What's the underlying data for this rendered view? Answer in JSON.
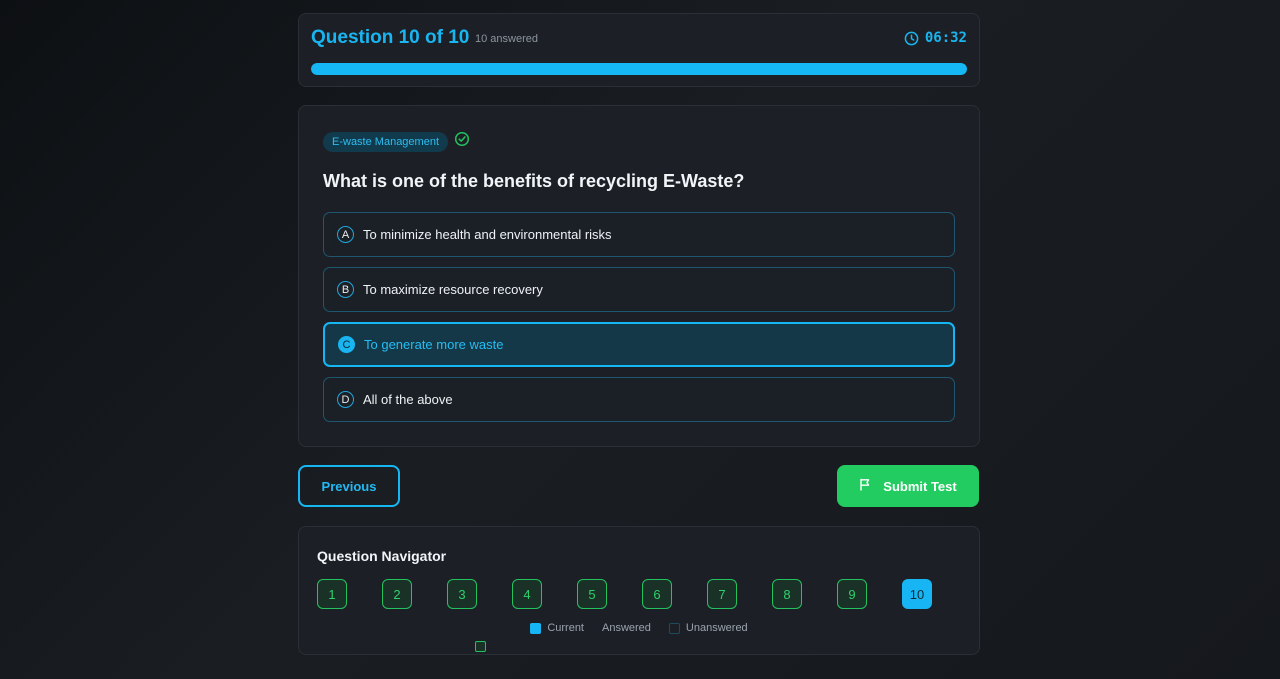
{
  "header": {
    "title": "Question 10 of 10",
    "answered": "10 answered",
    "timer": "06:32",
    "progress_fraction": 1.0,
    "accent_color": "#19b5f0"
  },
  "question": {
    "topic": "E-waste Management",
    "text": "What is one of the benefits of recycling E-Waste?",
    "options": [
      {
        "letter": "A",
        "text": "To minimize health and environmental risks",
        "selected": false
      },
      {
        "letter": "B",
        "text": "To maximize resource recovery",
        "selected": false
      },
      {
        "letter": "C",
        "text": "To generate more waste",
        "selected": true
      },
      {
        "letter": "D",
        "text": "All of the above",
        "selected": false
      }
    ]
  },
  "actions": {
    "previous_label": "Previous",
    "submit_label": "Submit Test",
    "submit_color": "#22cc60"
  },
  "navigator": {
    "title": "Question Navigator",
    "items": [
      {
        "label": "1",
        "status": "answered"
      },
      {
        "label": "2",
        "status": "answered"
      },
      {
        "label": "3",
        "status": "answered"
      },
      {
        "label": "4",
        "status": "answered"
      },
      {
        "label": "5",
        "status": "answered"
      },
      {
        "label": "6",
        "status": "answered"
      },
      {
        "label": "7",
        "status": "answered"
      },
      {
        "label": "8",
        "status": "answered"
      },
      {
        "label": "9",
        "status": "answered"
      },
      {
        "label": "10",
        "status": "current"
      }
    ],
    "legend": {
      "current": "Current",
      "answered": "Answered",
      "unanswered": "Unanswered"
    }
  }
}
